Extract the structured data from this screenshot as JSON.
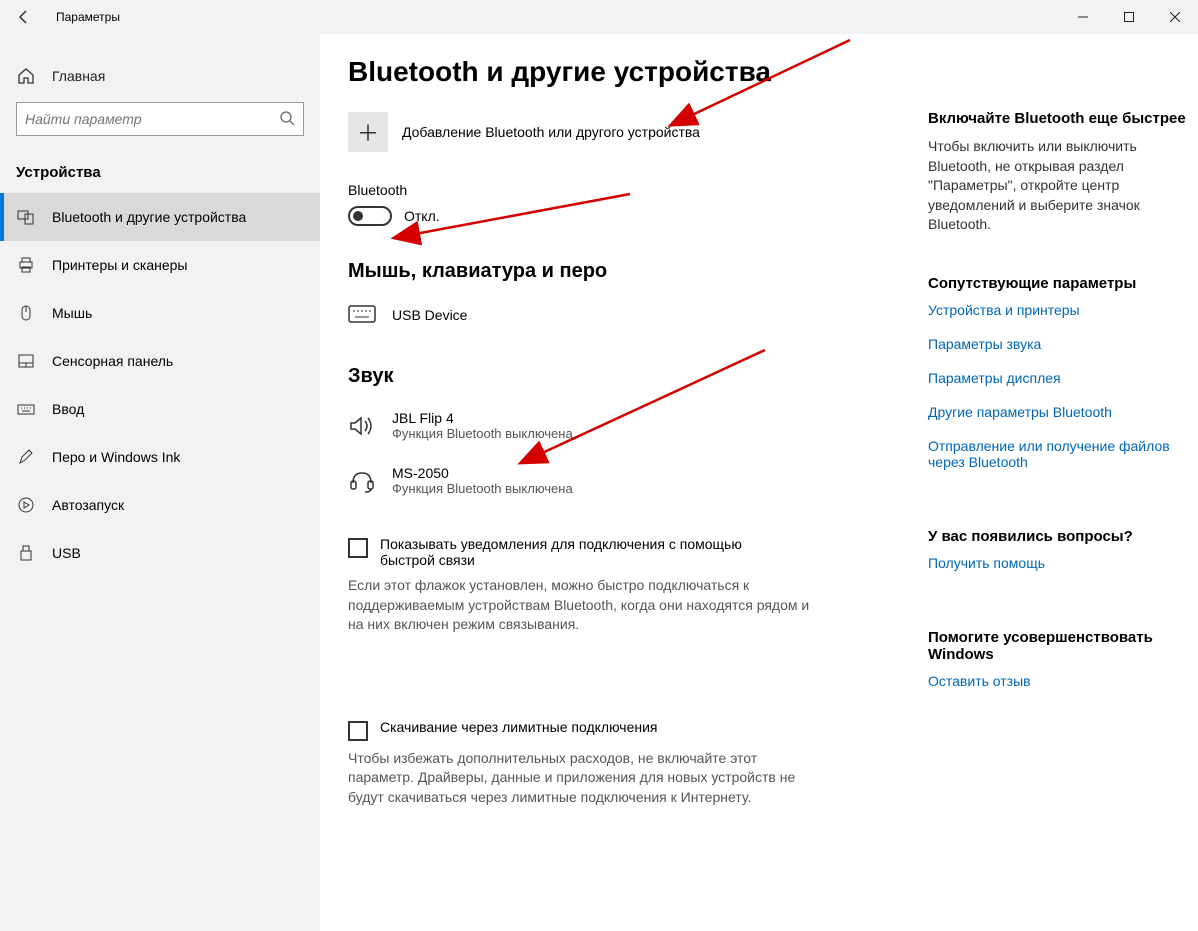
{
  "window": {
    "title": "Параметры"
  },
  "sidebar": {
    "home": "Главная",
    "search_placeholder": "Найти параметр",
    "section": "Устройства",
    "items": [
      {
        "label": "Bluetooth и другие устройства"
      },
      {
        "label": "Принтеры и сканеры"
      },
      {
        "label": "Мышь"
      },
      {
        "label": "Сенсорная панель"
      },
      {
        "label": "Ввод"
      },
      {
        "label": "Перо и Windows Ink"
      },
      {
        "label": "Автозапуск"
      },
      {
        "label": "USB"
      }
    ]
  },
  "main": {
    "title": "Bluetooth и другие устройства",
    "add_device": "Добавление Bluetooth или другого устройства",
    "bt_label": "Bluetooth",
    "bt_state": "Откл.",
    "sec_mouse": "Мышь, клавиатура и перо",
    "usb_device": "USB Device",
    "sec_sound": "Звук",
    "dev1_name": "JBL Flip 4",
    "dev1_sub": "Функция Bluetooth выключена",
    "dev2_name": "MS-2050",
    "dev2_sub": "Функция Bluetooth выключена",
    "check1_label": "Показывать уведомления для подключения с помощью быстрой связи",
    "check1_desc": "Если этот флажок установлен, можно быстро подключаться к поддерживаемым устройствам Bluetooth, когда они находятся рядом и на них включен режим связывания.",
    "check2_label": "Скачивание через лимитные подключения",
    "check2_desc": "Чтобы избежать дополнительных расходов, не включайте этот параметр. Драйверы, данные и приложения для новых устройств не будут скачиваться через лимитные подключения к Интернету."
  },
  "side": {
    "tip_head": "Включайте Bluetooth еще быстрее",
    "tip_text": "Чтобы включить или выключить Bluetooth, не открывая раздел \"Параметры\", откройте центр уведомлений и выберите значок Bluetooth.",
    "related_head": "Сопутствующие параметры",
    "links": [
      "Устройства и принтеры",
      "Параметры звука",
      "Параметры дисплея",
      "Другие параметры Bluetooth",
      "Отправление или получение файлов через Bluetooth"
    ],
    "q_head": "У вас появились вопросы?",
    "q_link": "Получить помощь",
    "fb_head": "Помогите усовершенствовать Windows",
    "fb_link": "Оставить отзыв"
  }
}
